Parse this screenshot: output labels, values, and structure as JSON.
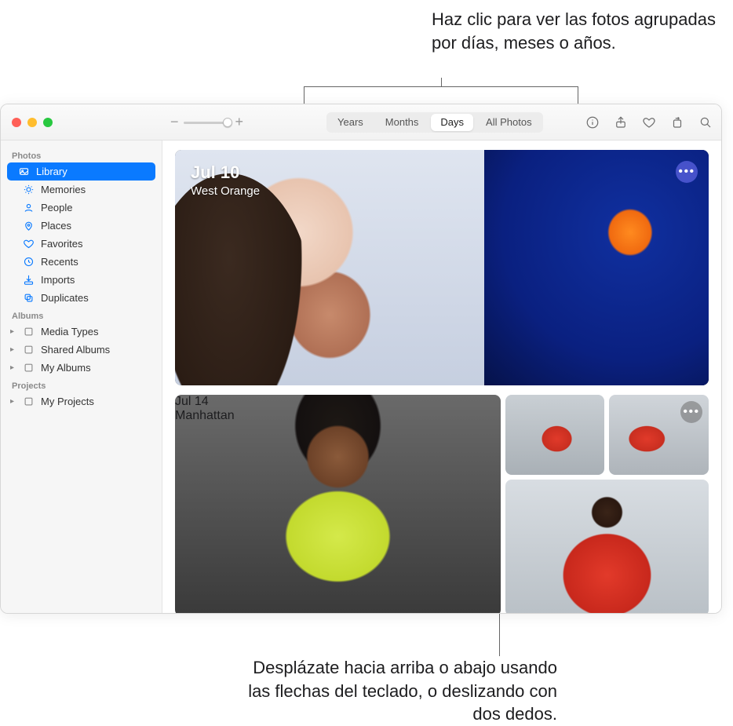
{
  "callouts": {
    "top": "Haz clic para ver las fotos agrupadas por días, meses o años.",
    "bottom": "Desplázate hacia arriba o abajo usando las flechas del teclado, o deslizando con dos dedos."
  },
  "toolbar": {
    "zoom_minus": "−",
    "zoom_plus": "+",
    "segments": {
      "years": "Years",
      "months": "Months",
      "days": "Days",
      "all": "All Photos"
    },
    "active_segment": "Days"
  },
  "sidebar": {
    "sections": {
      "photos": "Photos",
      "albums": "Albums",
      "projects": "Projects"
    },
    "photos_items": {
      "library": "Library",
      "memories": "Memories",
      "people": "People",
      "places": "Places",
      "favorites": "Favorites",
      "recents": "Recents",
      "imports": "Imports",
      "duplicates": "Duplicates"
    },
    "albums_items": {
      "media_types": "Media Types",
      "shared_albums": "Shared Albums",
      "my_albums": "My Albums"
    },
    "projects_items": {
      "my_projects": "My Projects"
    }
  },
  "main": {
    "groups": [
      {
        "date": "Jul 10",
        "place": "West Orange"
      },
      {
        "date": "Jul 14",
        "place": "Manhattan"
      }
    ],
    "more_glyph": "•••"
  }
}
